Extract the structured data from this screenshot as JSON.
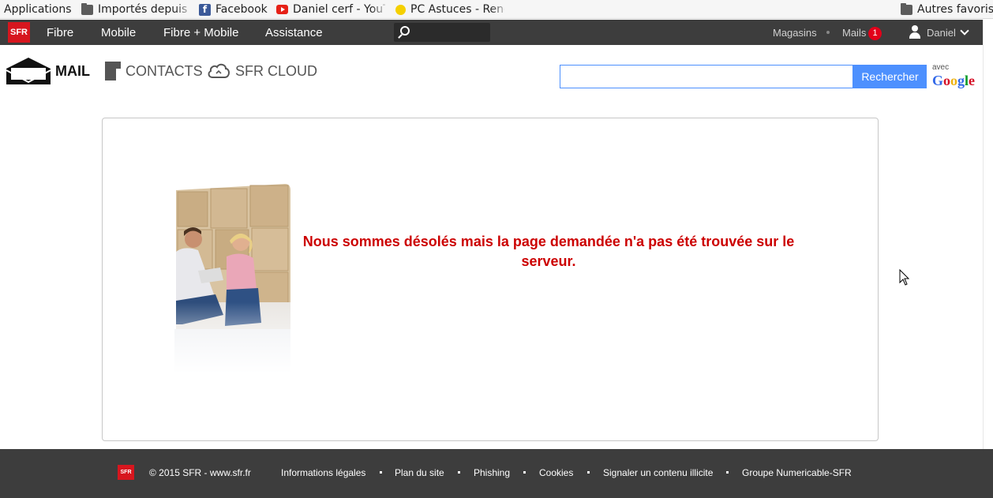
{
  "bookmarks": {
    "items": [
      {
        "label": "Applications"
      },
      {
        "label": "Importés depuis I"
      },
      {
        "label": "Facebook"
      },
      {
        "label": "Daniel cerf - YouT"
      },
      {
        "label": "PC Astuces - Renc"
      }
    ],
    "other_label": "Autres favoris"
  },
  "topnav": {
    "logo": "SFR",
    "links": [
      "Fibre",
      "Mobile",
      "Fibre + Mobile",
      "Assistance"
    ],
    "stores_label": "Magasins",
    "mails_label": "Mails",
    "mails_count": "1",
    "user_name": "Daniel"
  },
  "product_tabs": {
    "mail": "MAIL",
    "contacts": "CONTACTS",
    "cloud": "SFR CLOUD"
  },
  "search": {
    "value": "",
    "button_label": "Rechercher",
    "avec": "avec",
    "provider": [
      "G",
      "o",
      "o",
      "g",
      "l",
      "e"
    ]
  },
  "error": {
    "message": "Nous sommes désolés mais la page demandée n'a pas été trouvée sur le serveur."
  },
  "footer": {
    "logo": "SFR",
    "copyright": "© 2015 SFR - www.sfr.fr",
    "links": [
      "Informations légales",
      "Plan du site",
      "Phishing",
      "Cookies",
      "Signaler un contenu illicite",
      "Groupe Numericable-SFR"
    ]
  },
  "colors": {
    "brand_red": "#d7161e",
    "nav_bg": "#3d3d3d",
    "error_red": "#cc0000",
    "search_blue": "#4d90fe",
    "google": [
      "#3369e8",
      "#d50f25",
      "#eeb211",
      "#3369e8",
      "#009925",
      "#d50f25"
    ]
  }
}
